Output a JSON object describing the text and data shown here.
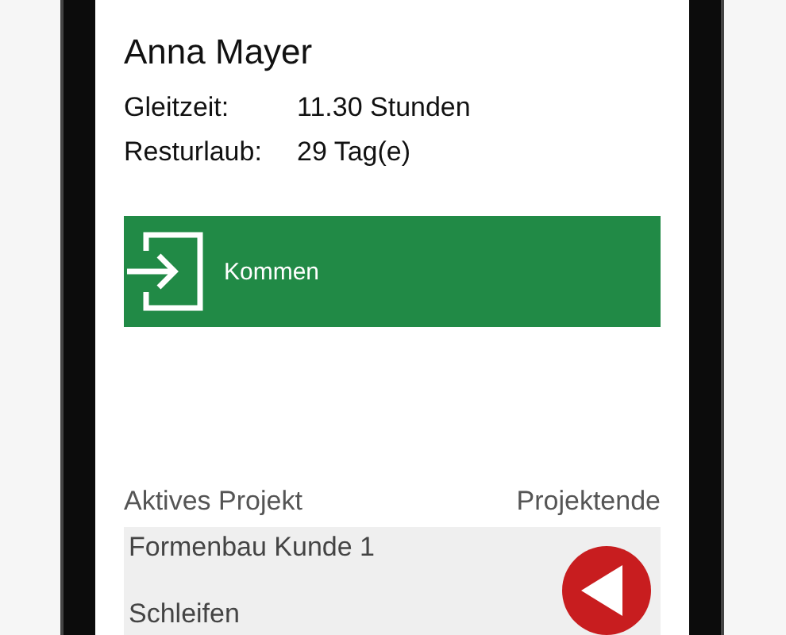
{
  "user": {
    "name": "Anna Mayer"
  },
  "info_rows": [
    {
      "label": "Gleitzeit:",
      "value": "11.30 Stunden"
    },
    {
      "label": "Resturlaub:",
      "value": "29 Tag(e)"
    }
  ],
  "clock_button": {
    "label": "Kommen"
  },
  "project_header": {
    "left": "Aktives Projekt",
    "right": "Projektende"
  },
  "project": {
    "name": "Formenbau Kunde 1",
    "task": "Schleifen"
  }
}
